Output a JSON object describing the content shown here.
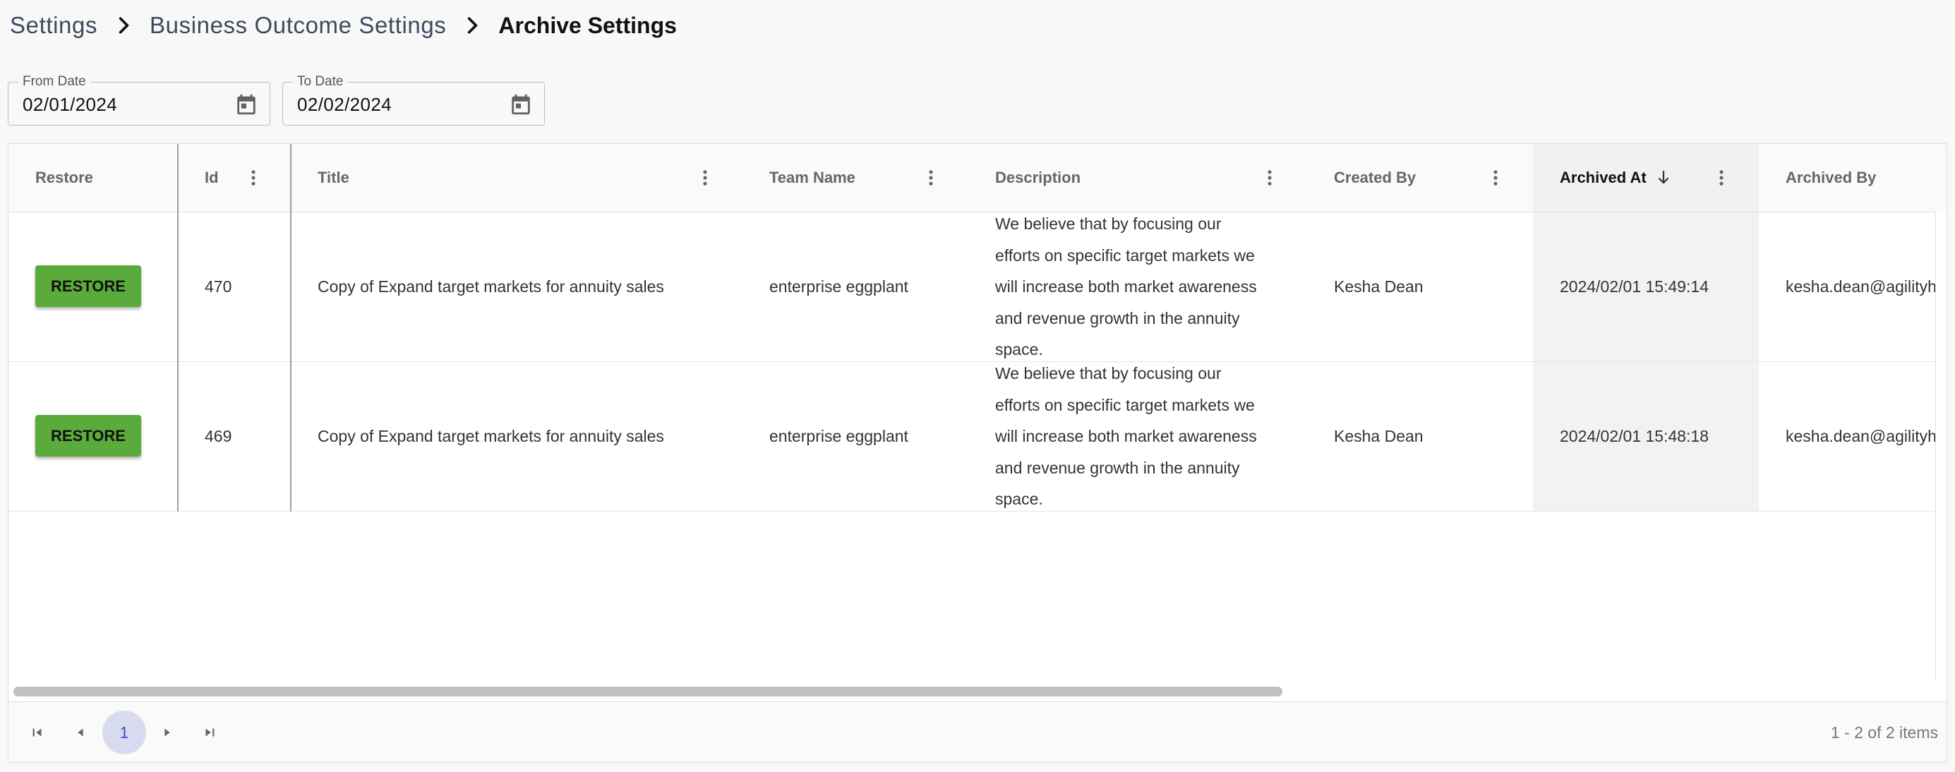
{
  "breadcrumb": {
    "items": [
      "Settings",
      "Business Outcome Settings"
    ],
    "current": "Archive Settings"
  },
  "filters": {
    "from": {
      "label": "From Date",
      "value": "02/01/2024"
    },
    "to": {
      "label": "To Date",
      "value": "02/02/2024"
    }
  },
  "grid": {
    "columns": {
      "restore": "Restore",
      "id": "Id",
      "title": "Title",
      "team": "Team Name",
      "description": "Description",
      "created_by": "Created By",
      "archived_at": "Archived At",
      "archived_by": "Archived By"
    },
    "sorted_column": "archived_at",
    "sort_direction": "descending",
    "restore_label": "RESTORE",
    "rows": [
      {
        "id": "470",
        "title": "Copy of Expand target markets for annuity sales",
        "team": "enterprise eggplant",
        "description": "We believe that by focusing our efforts on specific target markets we will increase both market awareness and revenue growth in the annuity space.",
        "created_by": "Kesha Dean",
        "archived_at": "2024/02/01 15:49:14",
        "archived_by": "kesha.dean@agilityh"
      },
      {
        "id": "469",
        "title": "Copy of Expand target markets for annuity sales",
        "team": "enterprise eggplant",
        "description": "We believe that by focusing our efforts on specific target markets we will increase both market awareness and revenue growth in the annuity space.",
        "created_by": "Kesha Dean",
        "archived_at": "2024/02/01 15:48:18",
        "archived_by": "kesha.dean@agilityh"
      }
    ]
  },
  "pager": {
    "current_page": "1",
    "info": "1 - 2 of 2 items"
  },
  "colors": {
    "restore_button": "#5aab3b",
    "page_highlight": "#d8dbf0",
    "page_text": "#3f51b5"
  }
}
